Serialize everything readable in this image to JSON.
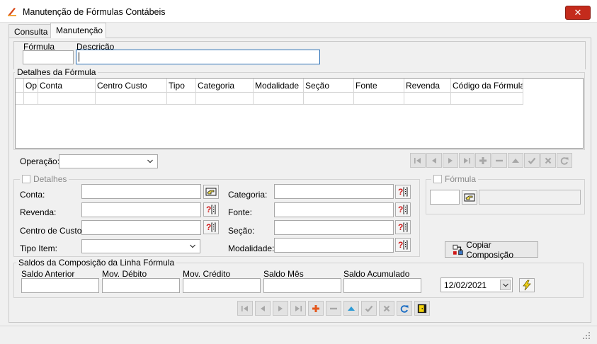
{
  "window": {
    "title": "Manutenção de Fórmulas Contábeis",
    "close_label": "✕"
  },
  "tabs": [
    {
      "label": "Consulta"
    },
    {
      "label": "Manutenção"
    }
  ],
  "header": {
    "formula_label": "Fórmula",
    "formula_value": "",
    "descricao_label": "Descrição",
    "descricao_value": ""
  },
  "detalhes_formula": {
    "legend": "Detalhes da Fórmula",
    "columns": [
      "Op.",
      "Conta",
      "Centro Custo",
      "Tipo",
      "Categoria",
      "Modalidade",
      "Seção",
      "Fonte",
      "Revenda",
      "Código da Fórmula"
    ]
  },
  "operacao": {
    "label": "Operação:",
    "value": ""
  },
  "detalhes": {
    "legend": "Detalhes",
    "conta_label": "Conta:",
    "revenda_label": "Revenda:",
    "centro_custo_label": "Centro de Custo:",
    "tipo_item_label": "Tipo Item:",
    "categoria_label": "Categoria:",
    "fonte_label": "Fonte:",
    "secao_label": "Seção:",
    "modalidade_label": "Modalidade:"
  },
  "formula_group": {
    "legend": "Fórmula",
    "code_value": "",
    "desc_value": ""
  },
  "copiar_button": {
    "label": "Copiar Composição"
  },
  "saldos": {
    "legend": "Saldos da Composição da Linha Fórmula",
    "saldo_anterior_label": "Saldo Anterior",
    "mov_debito_label": "Mov. Débito",
    "mov_credito_label": "Mov. Crédito",
    "saldo_mes_label": "Saldo Mês",
    "saldo_acumulado_label": "Saldo Acumulado",
    "date_value": "12/02/2021"
  },
  "colors": {
    "accent_blue": "#2a6fb5",
    "help_red": "#d01818",
    "add_orange": "#e4571c",
    "close_red": "#c42b1c"
  }
}
